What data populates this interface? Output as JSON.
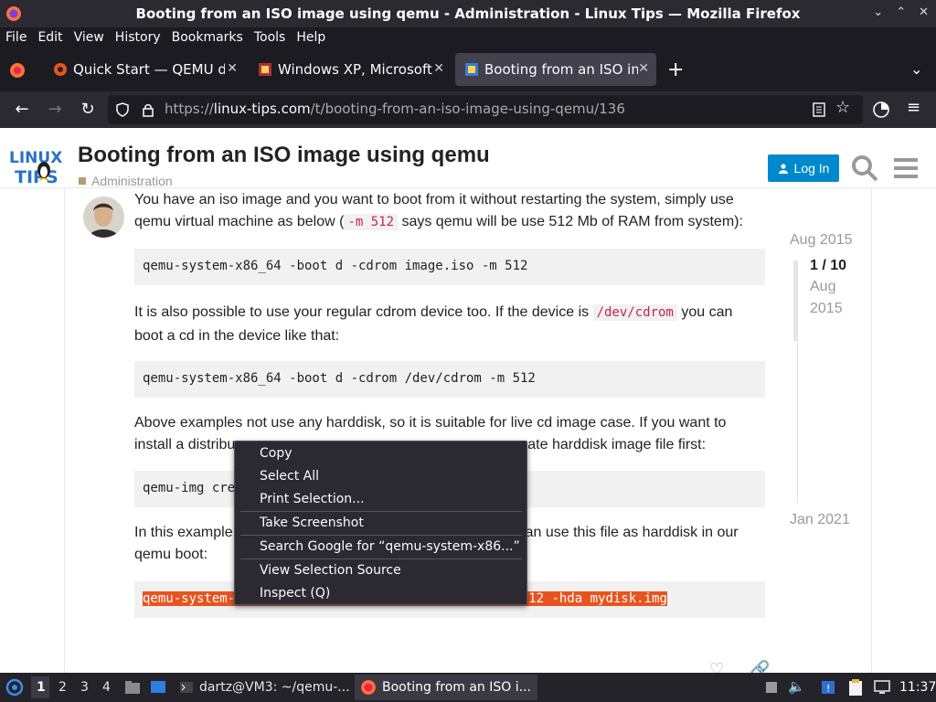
{
  "window": {
    "title": "Booting from an ISO image using qemu - Administration - Linux Tips — Mozilla Firefox",
    "controls": [
      "⌄",
      "⌃",
      "✕"
    ]
  },
  "menu": [
    "File",
    "Edit",
    "View",
    "History",
    "Bookmarks",
    "Tools",
    "Help"
  ],
  "tabs": [
    {
      "label": "Quick Start — QEMU doc",
      "active": false
    },
    {
      "label": "Windows XP, Microsoft - C",
      "active": false
    },
    {
      "label": "Booting from an ISO ima",
      "active": true
    }
  ],
  "url": {
    "prefix": "https://",
    "domain": "linux-tips.com",
    "path": "/t/booting-from-an-iso-image-using-qemu/136"
  },
  "header": {
    "title": "Booting from an ISO image using qemu",
    "category": "Administration",
    "login_label": "Log In"
  },
  "post": {
    "p1a": "You have an iso image and you want to boot from it without restarting the system, simply use",
    "p1b_pre": "qemu virtual machine as below (",
    "p1b_code": "-m 512",
    "p1b_post": " says qemu will be use 512 Mb of RAM from system):",
    "code1": "qemu-system-x86_64 -boot d -cdrom image.iso -m 512",
    "p2a_pre": "It is also possible to use your regular cdrom device too. If the device is ",
    "p2a_code": "/dev/cdrom",
    "p2a_post": " you can",
    "p2b": "boot a cd in the device like that:",
    "code2": "qemu-system-x86_64 -boot d -cdrom /dev/cdrom -m 512",
    "p3a": "Above examples not use any harddisk, so it is suitable for live cd image case. If you want to",
    "p3b_pre": "install a distribu",
    "p3b_post": "ate harddisk image file first:",
    "code3_visible": "qemu-img cre",
    "p4a_pre": "In this example",
    "p4a_post": "an use this file as harddisk in our",
    "p4b": "qemu boot:",
    "code4_left": "qemu-system-",
    "code4_right": "12 -hda mydisk.img"
  },
  "timeline": {
    "top_date": "Aug 2015",
    "position": "1 / 10",
    "pos_month": "Aug",
    "pos_year": "2015",
    "bottom_date": "Jan 2021"
  },
  "context_menu": {
    "items": [
      "Copy",
      "Select All",
      "Print Selection...",
      "Take Screenshot",
      "Search Google for “qemu-system-x86...”",
      "View Selection Source",
      "Inspect (Q)"
    ]
  },
  "taskbar": {
    "workspaces": [
      "1",
      "2",
      "3",
      "4"
    ],
    "terminal_label": "dartz@VM3: ~/qemu-...",
    "firefox_label": "Booting from an ISO i...",
    "clock": "11:37"
  }
}
